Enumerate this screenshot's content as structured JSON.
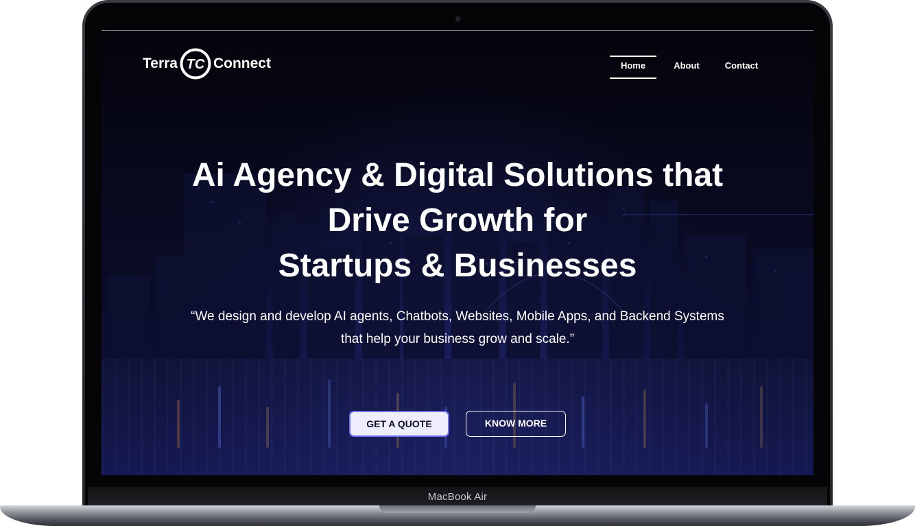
{
  "device": {
    "model_label": "MacBook Air"
  },
  "site": {
    "logo": {
      "left_text": "Terra",
      "mark_text": "TC",
      "right_text": "Connect"
    },
    "nav": {
      "items": [
        {
          "label": "Home",
          "active": true
        },
        {
          "label": "About",
          "active": false
        },
        {
          "label": "Contact",
          "active": false
        }
      ]
    },
    "hero": {
      "title_lines": [
        "Ai Agency & Digital Solutions that",
        "Drive Growth for",
        "Startups & Businesses"
      ],
      "subtitle_lines": [
        "“We design and develop AI agents, Chatbots, Websites, Mobile Apps, and Backend Systems",
        "that help your business grow and scale.”"
      ],
      "primary_button": "GET A QUOTE",
      "secondary_button": "KNOW MORE"
    }
  },
  "colors": {
    "background": "#07081a",
    "accent": "#6d6cf6",
    "text": "#ffffff"
  }
}
